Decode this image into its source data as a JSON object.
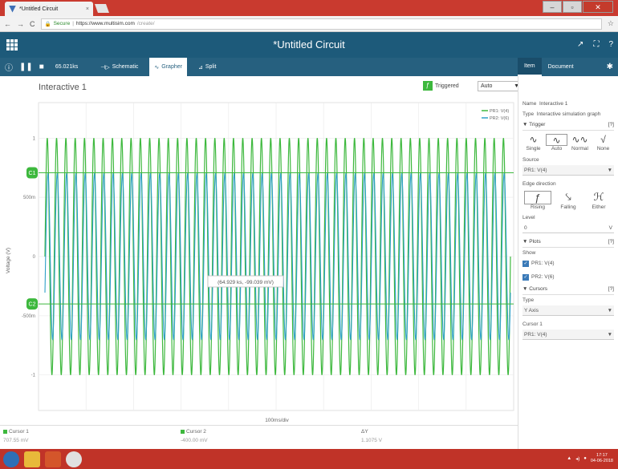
{
  "browser": {
    "tab_title": "*Untitled Circuit",
    "tab_close": "×",
    "url_secure": "Secure",
    "url_host": "https://www.multisim.com",
    "url_path": "/create/"
  },
  "app": {
    "title": "*Untitled Circuit"
  },
  "toolbar": {
    "sim_time": "65.021ks",
    "tabs": [
      {
        "label": "Schematic"
      },
      {
        "label": "Grapher"
      },
      {
        "label": "Split"
      }
    ]
  },
  "side_tabs": [
    {
      "label": "Item"
    },
    {
      "label": "Document"
    }
  ],
  "graph": {
    "title": "Interactive 1",
    "triggered_label": "Triggered",
    "mode_value": "Auto",
    "xdiv_label": "100ms/div",
    "ylabel": "Voltage (V)",
    "tooltip": "(64.929 ks, -99.039 mV)",
    "cursor_c1": "C1",
    "cursor_c2": "C2"
  },
  "chart_data": {
    "type": "line",
    "title": "",
    "xlabel": "100ms/div",
    "ylabel": "Voltage (V)",
    "ylim": [
      -1.3,
      1.3
    ],
    "yticks": [
      {
        "value": 1,
        "label": "1"
      },
      {
        "value": 0.5,
        "label": "500m"
      },
      {
        "value": 0,
        "label": "0"
      },
      {
        "value": -0.5,
        "label": "-500m"
      },
      {
        "value": -1,
        "label": "-1"
      }
    ],
    "cycles": 50,
    "series": [
      {
        "name": "PR1: V(4)",
        "color": "#3db83d",
        "amplitude": 1.0
      },
      {
        "name": "PR2: V(6)",
        "color": "#2fa0c8",
        "amplitude": 0.7
      }
    ],
    "cursors": [
      {
        "name": "C1",
        "value": 0.70755
      },
      {
        "name": "C2",
        "value": -0.4
      }
    ]
  },
  "panel": {
    "name_label": "Name",
    "name_value": "Interactive 1",
    "type_label": "Type",
    "type_value": "Interactive simulation graph",
    "trigger_section": "Trigger",
    "help": "[?]",
    "trigger_modes": [
      "Single",
      "Auto",
      "Normal",
      "None"
    ],
    "source_label": "Source",
    "source_value": "PR1: V(4)",
    "edge_label": "Edge direction",
    "edges": [
      "Rising",
      "Falling",
      "Either"
    ],
    "level_label": "Level",
    "level_value": "0",
    "level_unit": "V",
    "plots_section": "Plots",
    "show_label": "Show",
    "plots": [
      "PR1: V(4)",
      "PR2: V(6)"
    ],
    "cursors_section": "Cursors",
    "cursor_type_label": "Type",
    "cursor_type_value": "Y Axis",
    "cursor1_label": "Cursor 1",
    "cursor1_source": "PR1: V(4)"
  },
  "status": {
    "cursor1_label": "Cursor 1",
    "cursor1_value": "707.55 mV",
    "cursor2_label": "Cursor 2",
    "cursor2_value": "-400.00 mV",
    "dy_label": "ΔY",
    "dy_value": "1.1075 V"
  },
  "taskbar": {
    "clock_time": "17:17",
    "clock_date": "04-06-2018"
  },
  "colors": {
    "header": "#1d5a7a",
    "toolbar": "#26607f",
    "trace1": "#3db83d",
    "trace2": "#2fa0c8",
    "taskbar": "#c03328"
  }
}
